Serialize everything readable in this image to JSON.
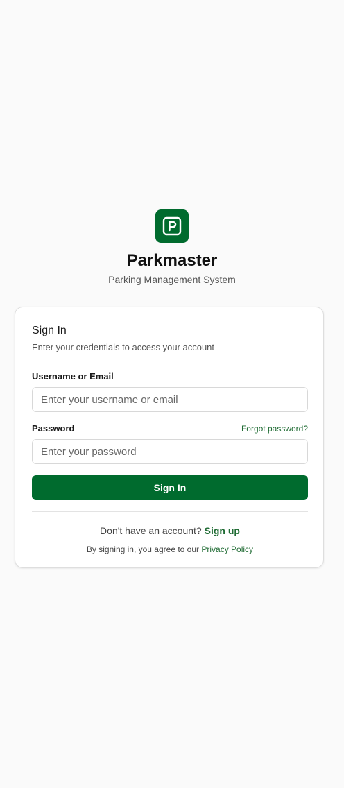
{
  "brand": {
    "logo_icon": "parking-p-icon",
    "name": "Parkmaster",
    "tagline": "Parking Management System"
  },
  "signin": {
    "title": "Sign In",
    "subtitle": "Enter your credentials to access your account",
    "username": {
      "label": "Username or Email",
      "placeholder": "Enter your username or email",
      "value": ""
    },
    "password": {
      "label": "Password",
      "placeholder": "Enter your password",
      "value": ""
    },
    "forgot_label": "Forgot password?",
    "button_label": "Sign In",
    "signup_prompt": "Don't have an account?",
    "signup_label": "Sign up",
    "policy_prefix": "By signing in, you agree to our",
    "policy_label": "Privacy Policy"
  },
  "colors": {
    "brand": "#006b2e",
    "link": "#1f6b33",
    "background": "#fafafa"
  }
}
